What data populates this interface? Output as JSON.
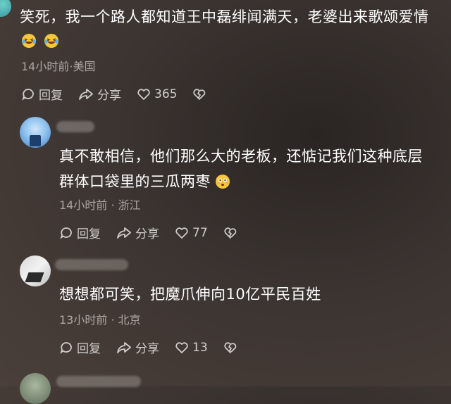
{
  "comments": [
    {
      "text_line1": "笑死，我一个路人都知道王中磊绯闻满天，老婆出来歌颂爱情",
      "emojis": [
        "laughing-crying-emoji",
        "laughing-crying-emoji"
      ],
      "meta": "14小时前·美国",
      "reply": "回复",
      "share": "分享",
      "likes": "365"
    },
    {
      "text_line1": "真不敢相信，他们那么大的老板，还惦记我们这种底层",
      "text_line2": "群体口袋里的三瓜两枣",
      "emojis": [
        "flushed-emoji"
      ],
      "meta": "14小时前 · 浙江",
      "reply": "回复",
      "share": "分享",
      "likes": "77"
    },
    {
      "text_line1": "想想都可笑，把魔爪伸向10亿平民百姓",
      "meta": "13小时前 · 北京",
      "reply": "回复",
      "share": "分享",
      "likes": "13"
    }
  ],
  "colors": {
    "background": "#3b3431",
    "text": "#ffffff",
    "meta": "#a39d99"
  }
}
